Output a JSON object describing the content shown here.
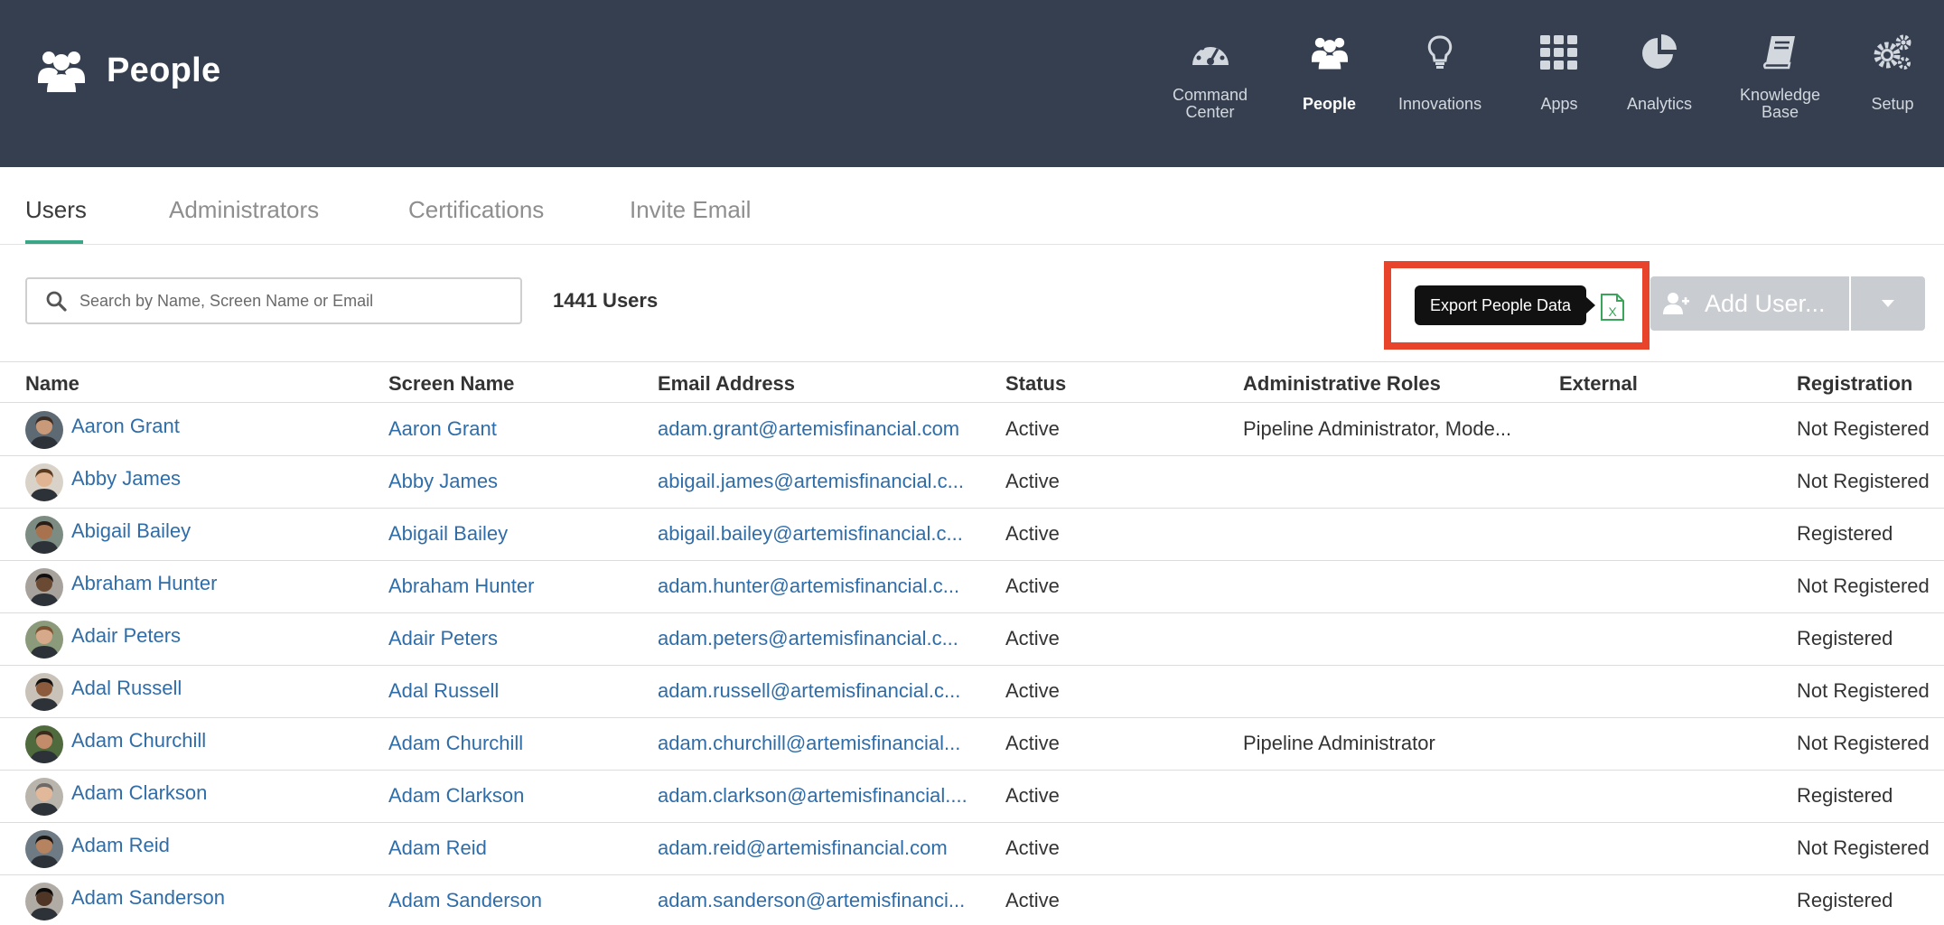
{
  "header": {
    "title": "People",
    "nav": [
      {
        "label": "Command\nCenter",
        "icon": "dashboard-gauge-icon"
      },
      {
        "label": "People",
        "icon": "people-icon",
        "active": true
      },
      {
        "label": "Innovations",
        "icon": "lightbulb-icon"
      },
      {
        "label": "Apps",
        "icon": "apps-grid-icon"
      },
      {
        "label": "Analytics",
        "icon": "pie-chart-icon"
      },
      {
        "label": "Knowledge\nBase",
        "icon": "book-icon"
      },
      {
        "label": "Setup",
        "icon": "gears-icon"
      }
    ]
  },
  "tabs": [
    "Users",
    "Administrators",
    "Certifications",
    "Invite Email"
  ],
  "toolbar": {
    "search_placeholder": "Search by Name, Screen Name or Email",
    "user_count": "1441 Users",
    "export_tooltip": "Export People Data",
    "add_user_label": "Add User..."
  },
  "table": {
    "columns": [
      "Name",
      "Screen Name",
      "Email Address",
      "Status",
      "Administrative Roles",
      "External",
      "Registration"
    ],
    "rows": [
      {
        "name": "Aaron Grant",
        "screen": "Aaron Grant",
        "email": "adam.grant@artemisfinancial.com",
        "status": "Active",
        "roles": "Pipeline Administrator, Mode...",
        "external": "",
        "registration": "Not Registered"
      },
      {
        "name": "Abby James",
        "screen": "Abby James",
        "email": "abigail.james@artemisfinancial.c...",
        "status": "Active",
        "roles": "",
        "external": "",
        "registration": "Not Registered"
      },
      {
        "name": "Abigail Bailey",
        "screen": "Abigail Bailey",
        "email": "abigail.bailey@artemisfinancial.c...",
        "status": "Active",
        "roles": "",
        "external": "",
        "registration": "Registered"
      },
      {
        "name": "Abraham Hunter",
        "screen": "Abraham Hunter",
        "email": "adam.hunter@artemisfinancial.c...",
        "status": "Active",
        "roles": "",
        "external": "",
        "registration": "Not Registered"
      },
      {
        "name": "Adair Peters",
        "screen": "Adair Peters",
        "email": "adam.peters@artemisfinancial.c...",
        "status": "Active",
        "roles": "",
        "external": "",
        "registration": "Registered"
      },
      {
        "name": "Adal Russell",
        "screen": "Adal Russell",
        "email": "adam.russell@artemisfinancial.c...",
        "status": "Active",
        "roles": "",
        "external": "",
        "registration": "Not Registered"
      },
      {
        "name": "Adam Churchill",
        "screen": "Adam Churchill",
        "email": "adam.churchill@artemisfinancial...",
        "status": "Active",
        "roles": "Pipeline Administrator",
        "external": "",
        "registration": "Not Registered"
      },
      {
        "name": "Adam Clarkson",
        "screen": "Adam Clarkson",
        "email": "adam.clarkson@artemisfinancial....",
        "status": "Active",
        "roles": "",
        "external": "",
        "registration": "Registered"
      },
      {
        "name": "Adam Reid",
        "screen": "Adam Reid",
        "email": "adam.reid@artemisfinancial.com",
        "status": "Active",
        "roles": "",
        "external": "",
        "registration": "Not Registered"
      },
      {
        "name": "Adam Sanderson",
        "screen": "Adam Sanderson",
        "email": "adam.sanderson@artemisfinanci...",
        "status": "Active",
        "roles": "",
        "external": "",
        "registration": "Registered"
      }
    ]
  },
  "colors": {
    "header_bg": "#353f4f",
    "link": "#2f6da9",
    "tab_active_underline": "#3aa888",
    "highlight": "#e8442c",
    "excel_green": "#3aa55a",
    "add_user_bg": "#c9ccd1"
  }
}
